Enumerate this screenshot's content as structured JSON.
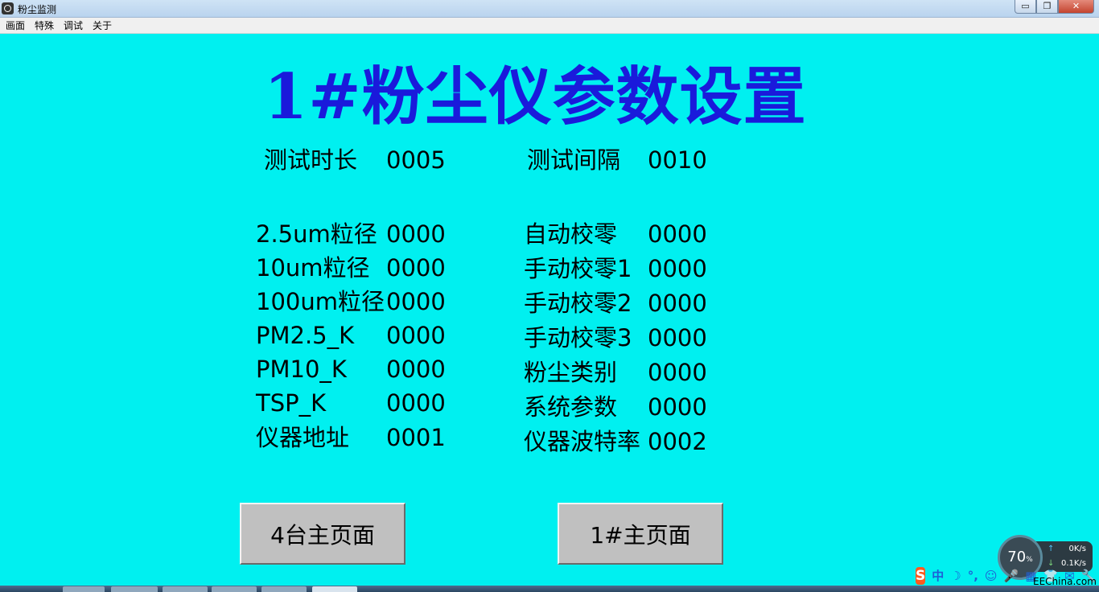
{
  "window": {
    "title": "粉尘监测"
  },
  "window_controls": {
    "minimize": "▭",
    "maximize": "❐",
    "close": "✕"
  },
  "menu": [
    "画面",
    "特殊",
    "调试",
    "关于"
  ],
  "page": {
    "title": "1#粉尘仪参数设置"
  },
  "params_top": [
    {
      "label": "测试时长",
      "value": "0005"
    },
    {
      "label": "测试间隔",
      "value": "0010"
    }
  ],
  "params_left": [
    {
      "label": "2.5um粒径",
      "value": "0000"
    },
    {
      "label": "10um粒径",
      "value": "0000"
    },
    {
      "label": "100um粒径",
      "value": "0000"
    },
    {
      "label": "PM2.5_K",
      "value": "0000"
    },
    {
      "label": "PM10_K",
      "value": "0000"
    },
    {
      "label": "TSP_K",
      "value": "0000"
    },
    {
      "label": "仪器地址",
      "value": "0001"
    }
  ],
  "params_right": [
    {
      "label": "自动校零",
      "value": "0000"
    },
    {
      "label": "手动校零1",
      "value": "0000"
    },
    {
      "label": "手动校零2",
      "value": "0000"
    },
    {
      "label": "手动校零3",
      "value": "0000"
    },
    {
      "label": "粉尘类别",
      "value": "0000"
    },
    {
      "label": "系统参数",
      "value": "0000"
    },
    {
      "label": "仪器波特率",
      "value": "0002"
    }
  ],
  "buttons": {
    "main4": "4台主页面",
    "main1": "1#主页面"
  },
  "speed_widget": {
    "percent": "70",
    "percent_unit": "%",
    "upload": "0K/s",
    "download": "0.1K/s"
  },
  "ime": {
    "logo": "S",
    "mode": "中",
    "items": [
      "☽",
      "°,",
      "☺",
      "🎤",
      "▦",
      "👕",
      "✉",
      "🔧"
    ]
  },
  "watermark": "EEChina.com",
  "colors": {
    "background": "#00f0f0",
    "title": "#1a1adb",
    "button": "#c0c0c0"
  }
}
